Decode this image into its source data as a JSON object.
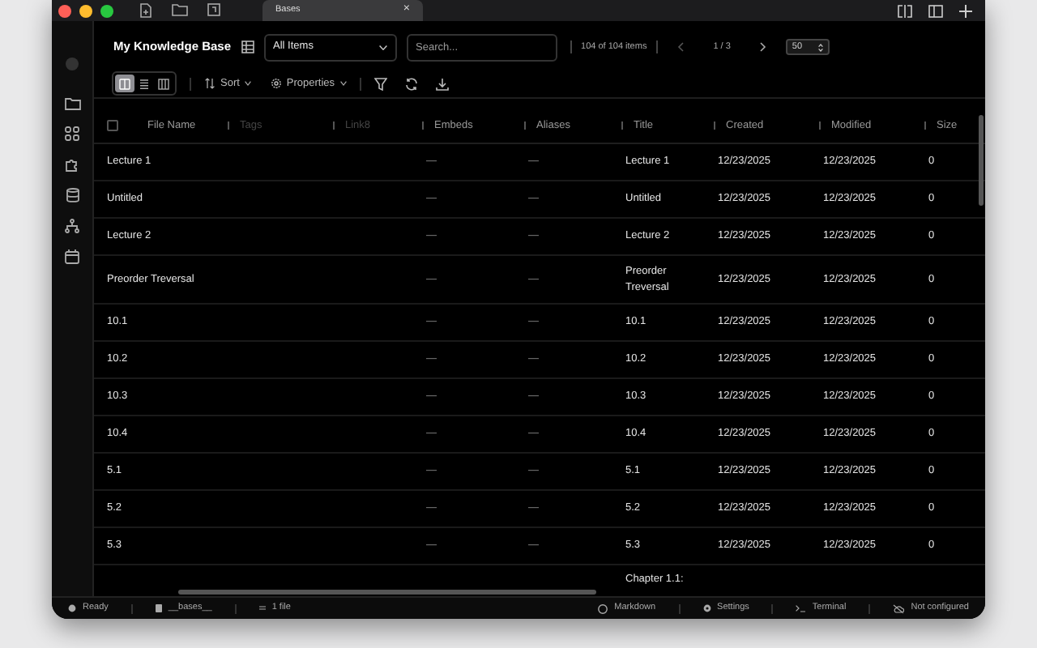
{
  "titlebar": {
    "tabs": [
      {
        "label": "Bases",
        "close": "×",
        "selected": true
      }
    ]
  },
  "header": {
    "title": "My Knowledge Base",
    "view_select": "All Items",
    "search": {
      "placeholder": "Search..."
    },
    "count": "104 of 104 items",
    "page": "1 / 3",
    "page_size": "50"
  },
  "toolbar": {
    "views": [
      {
        "selected": true
      },
      {
        "selected": false
      },
      {
        "selected": false
      }
    ],
    "sort": "Sort",
    "properties": "Properties"
  },
  "table": {
    "select_all_checked": false,
    "columns": [
      {
        "label": "File Name",
        "dimmed": false
      },
      {
        "label": "Tags",
        "dimmed": true
      },
      {
        "label": "Link8",
        "dimmed": true
      },
      {
        "label": "Embeds",
        "dimmed": false
      },
      {
        "label": "Aliases",
        "dimmed": false
      },
      {
        "label": "Title",
        "dimmed": false
      },
      {
        "label": "Created",
        "dimmed": false
      },
      {
        "label": "Modified",
        "dimmed": false
      },
      {
        "label": "Size",
        "dimmed": false
      }
    ],
    "rows": [
      {
        "cells": [
          "Lecture 1",
          "",
          "",
          "—",
          "—",
          "Lecture 1",
          "12/23/2025",
          "12/23/2025",
          "0"
        ]
      },
      {
        "cells": [
          "Untitled",
          "",
          "",
          "—",
          "—",
          "Untitled",
          "12/23/2025",
          "12/23/2025",
          "0"
        ]
      },
      {
        "cells": [
          "Lecture 2",
          "",
          "",
          "—",
          "—",
          "Lecture 2",
          "12/23/2025",
          "12/23/2025",
          "0"
        ]
      },
      {
        "cells": [
          "Preorder Treversal",
          "",
          "",
          "—",
          "—",
          "Preorder Treversal",
          "12/23/2025",
          "12/23/2025",
          "0"
        ]
      },
      {
        "cells": [
          "10.1",
          "",
          "",
          "—",
          "—",
          "10.1",
          "12/23/2025",
          "12/23/2025",
          "0"
        ]
      },
      {
        "cells": [
          "10.2",
          "",
          "",
          "—",
          "—",
          "10.2",
          "12/23/2025",
          "12/23/2025",
          "0"
        ]
      },
      {
        "cells": [
          "10.3",
          "",
          "",
          "—",
          "—",
          "10.3",
          "12/23/2025",
          "12/23/2025",
          "0"
        ]
      },
      {
        "cells": [
          "10.4",
          "",
          "",
          "—",
          "—",
          "10.4",
          "12/23/2025",
          "12/23/2025",
          "0"
        ]
      },
      {
        "cells": [
          "5.1",
          "",
          "",
          "—",
          "—",
          "5.1",
          "12/23/2025",
          "12/23/2025",
          "0"
        ]
      },
      {
        "cells": [
          "5.2",
          "",
          "",
          "—",
          "—",
          "5.2",
          "12/23/2025",
          "12/23/2025",
          "0"
        ]
      },
      {
        "cells": [
          "5.3",
          "",
          "",
          "—",
          "—",
          "5.3",
          "12/23/2025",
          "12/23/2025",
          "0"
        ]
      },
      {
        "cells": [
          "",
          "",
          "",
          "",
          "",
          "Chapter 1.1:",
          "",
          "",
          ""
        ]
      }
    ]
  },
  "status_bar": {
    "left": [
      "Ready",
      "__bases__",
      "1 file"
    ],
    "right": [
      "Markdown",
      "Settings",
      "Terminal",
      "Not configured"
    ]
  }
}
